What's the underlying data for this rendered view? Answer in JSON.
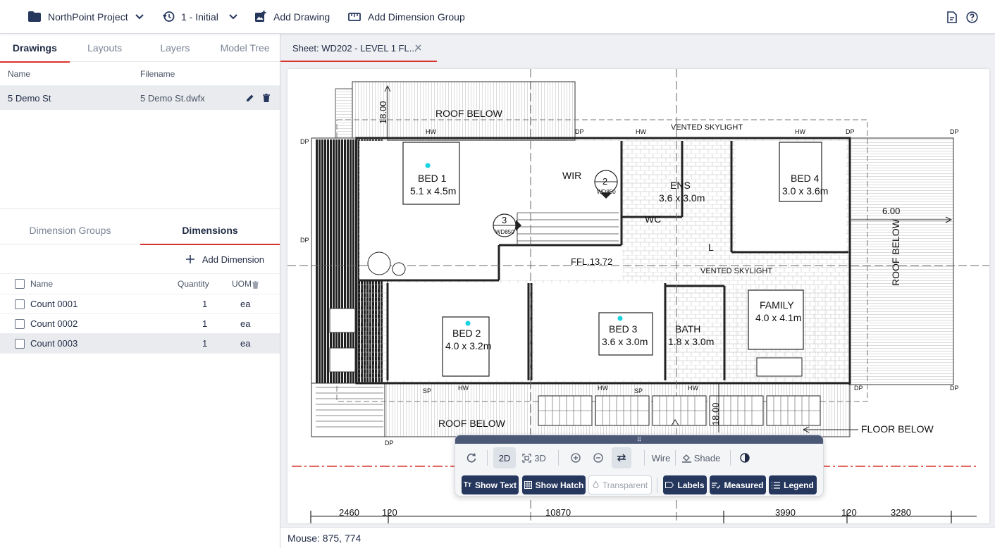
{
  "topbar": {
    "project_name": "NorthPoint Project",
    "revision": "1 - Initial",
    "add_drawing": "Add Drawing",
    "add_dimension_group": "Add Dimension Group"
  },
  "left_tabs": [
    "Drawings",
    "Layouts",
    "Layers",
    "Model Tree"
  ],
  "drawings": {
    "col_name": "Name",
    "col_filename": "Filename",
    "rows": [
      {
        "name": "5 Demo St",
        "filename": "5 Demo St.dwfx"
      }
    ]
  },
  "dim_tabs": [
    "Dimension Groups",
    "Dimensions"
  ],
  "dimensions": {
    "add_label": "Add Dimension",
    "col_name": "Name",
    "col_quantity": "Quantity",
    "col_uom": "UOM",
    "rows": [
      {
        "name": "Count 0001",
        "quantity": "1",
        "uom": "ea"
      },
      {
        "name": "Count 0002",
        "quantity": "1",
        "uom": "ea"
      },
      {
        "name": "Count 0003",
        "quantity": "1",
        "uom": "ea"
      }
    ]
  },
  "sheet_tab": "Sheet: WD202 - LEVEL 1 FL...",
  "status": {
    "mouse": "Mouse: 875, 774"
  },
  "viewbar": {
    "btn_2d": "2D",
    "btn_3d": "3D",
    "btn_wire": "Wire",
    "btn_shade": "Shade",
    "show_text": "Show Text",
    "show_hatch": "Show Hatch",
    "transparent": "Transparent",
    "labels": "Labels",
    "measured": "Measured",
    "legend": "Legend"
  },
  "plan": {
    "roof_below_top": "ROOF BELOW",
    "roof_below_bottom": "ROOF BELOW",
    "roof_below_right": "ROOF BELOW",
    "dim_18_top": "18.00",
    "dim_18_bottom": "18.00",
    "dim_6": "6.00",
    "bed1": "BED 1",
    "bed1_size": "5.1 x 4.5m",
    "bed2": "BED 2",
    "bed2_size": "4.0 x 3.2m",
    "bed3": "BED 3",
    "bed3_size": "3.6 x 3.0m",
    "bed4": "BED 4",
    "bed4_size": "3.0 x 3.6m",
    "wir": "WIR",
    "ens": "ENS",
    "ens_size": "3.6 x 3.0m",
    "wc": "WC",
    "l": "L",
    "bath": "BATH",
    "bath_size": "1.8 x 3.0m",
    "family": "FAMILY",
    "family_size": "4.0 x 4.1m",
    "ffl": "FFL.13.72",
    "vented1": "VENTED SKYLIGHT",
    "vented2": "VENTED SKYLIGHT",
    "floor_below": "FLOOR BELOW",
    "callout2_num": "2",
    "callout2_ref": "WD850",
    "callout3_num": "3",
    "callout3_ref": "WD850",
    "dims": [
      "2460",
      "120",
      "10870",
      "3990",
      "120",
      "3280"
    ],
    "dp": "DP",
    "hw": "HW",
    "sp": "SP"
  }
}
